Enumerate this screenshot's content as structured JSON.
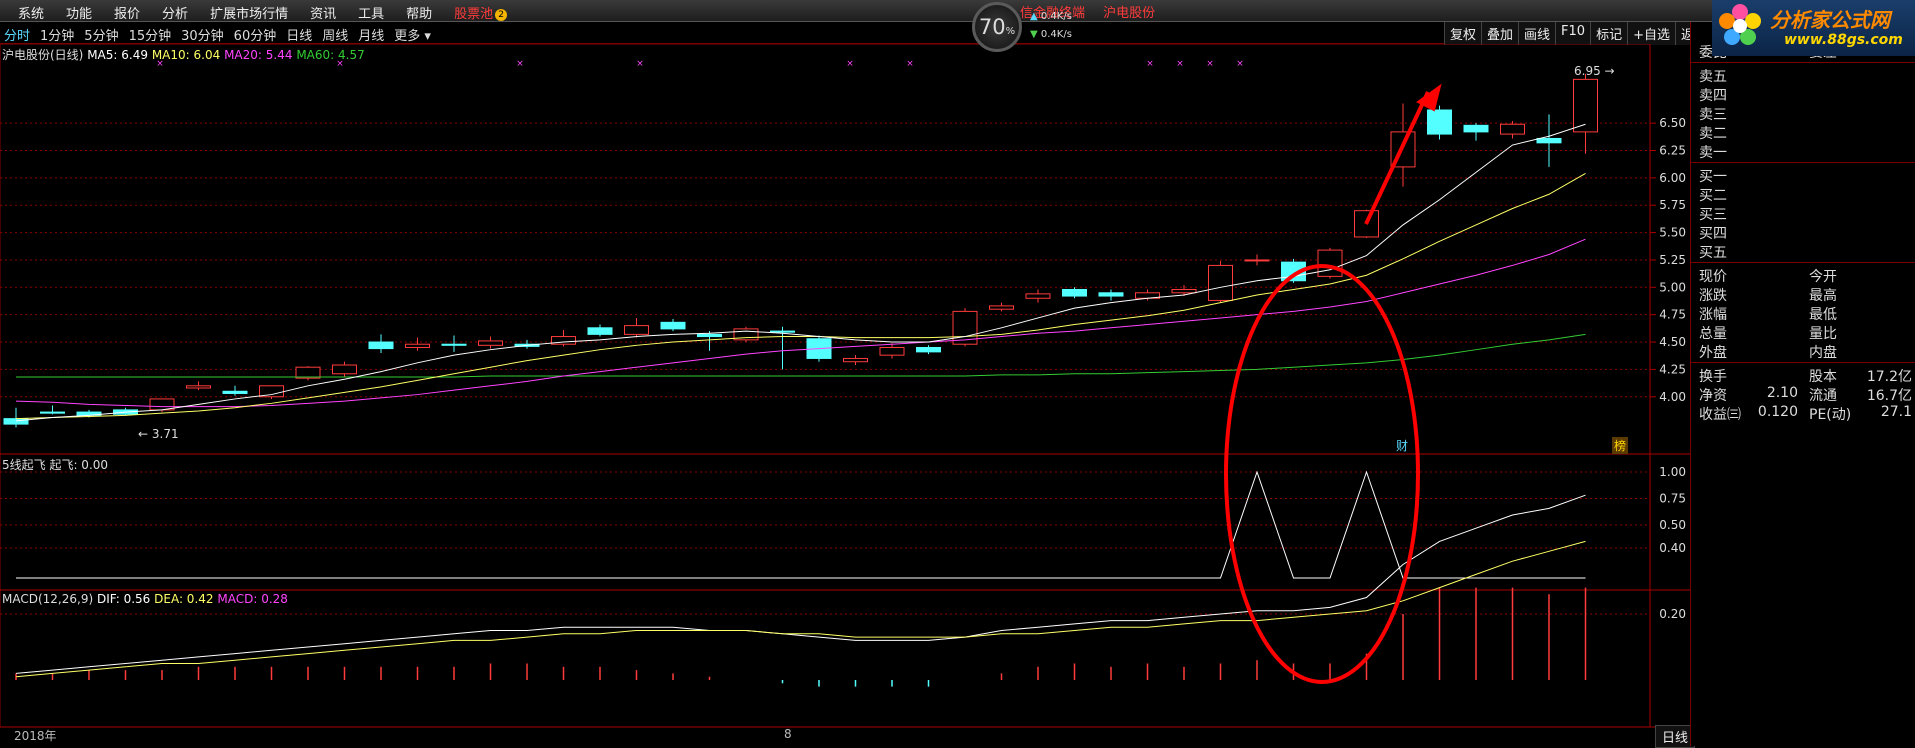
{
  "menu": {
    "items": [
      "系统",
      "功能",
      "报价",
      "分析",
      "扩展市场行情",
      "资讯",
      "工具",
      "帮助"
    ],
    "pool_label": "股票池",
    "pool_badge": "2"
  },
  "title_info": {
    "left": "信金融终端",
    "stock": "沪电股份"
  },
  "speed": {
    "percent": "70",
    "percent_sign": "%",
    "up_rate": "0.4",
    "down_rate": "0.4",
    "rate_unit": "K/s"
  },
  "logo": {
    "name": "分析家公式网",
    "url": "www.88gs.com"
  },
  "periods": [
    {
      "label": "分时",
      "active": true
    },
    {
      "label": "1分钟",
      "active": false
    },
    {
      "label": "5分钟",
      "active": false
    },
    {
      "label": "15分钟",
      "active": false
    },
    {
      "label": "30分钟",
      "active": false
    },
    {
      "label": "60分钟",
      "active": false
    },
    {
      "label": "日线",
      "active": false
    },
    {
      "label": "周线",
      "active": false
    },
    {
      "label": "月线",
      "active": false
    },
    {
      "label": "更多 ▾",
      "active": false
    }
  ],
  "right_buttons": [
    "复权",
    "叠加",
    "画线",
    "F10",
    "标记",
    "+自选",
    "返回"
  ],
  "legend": {
    "stock": "沪电股份(日线)",
    "ma5": "MA5: 6.49",
    "ma10": "MA10: 6.04",
    "ma20": "MA20: 5.44",
    "ma60": "MA60: 4.57",
    "ind1": "5线起飞  起飞: 0.00",
    "macd_name": "MACD(12,26,9)",
    "dif": "DIF: 0.56",
    "dea": "DEA: 0.42",
    "macd": "MACD: 0.28"
  },
  "colors": {
    "up": "#ff3b3b",
    "down": "#54ffff",
    "ma5": "#ffffff",
    "ma10": "#ffff66",
    "ma20": "#ff44ff",
    "ma60": "#33cc33",
    "grid": "#8a0000",
    "annotation": "#ff0000"
  },
  "marks": {
    "high": "6.95",
    "low": "3.71",
    "cai": "财",
    "bang": "榜"
  },
  "axis_labels": {
    "date1": "2018年",
    "date2": "8"
  },
  "daily_tab": "日线",
  "quote": {
    "header": {
      "left": "委比",
      "right": "委差"
    },
    "asks": [
      "卖五",
      "卖四",
      "卖三",
      "卖二",
      "卖一"
    ],
    "bids": [
      "买一",
      "买二",
      "买三",
      "买四",
      "买五"
    ],
    "stats": [
      {
        "l": "现价",
        "lv": "",
        "r": "今开",
        "rv": ""
      },
      {
        "l": "涨跌",
        "lv": "",
        "r": "最高",
        "rv": ""
      },
      {
        "l": "涨幅",
        "lv": "",
        "r": "最低",
        "rv": ""
      },
      {
        "l": "总量",
        "lv": "",
        "r": "量比",
        "rv": ""
      },
      {
        "l": "外盘",
        "lv": "",
        "r": "内盘",
        "rv": ""
      }
    ],
    "fin": [
      {
        "l": "换手",
        "lv": "",
        "r": "股本",
        "rv": "17.2亿"
      },
      {
        "l": "净资",
        "lv": "2.10",
        "r": "流通",
        "rv": "16.7亿"
      },
      {
        "l": "收益㈢",
        "lv": "0.120",
        "r": "PE(动)",
        "rv": "27.1"
      }
    ]
  },
  "chart_data": {
    "type": "candlestick",
    "price_ticks": [
      4.0,
      4.25,
      4.5,
      4.75,
      5.0,
      5.25,
      5.5,
      5.75,
      6.0,
      6.25,
      6.5
    ],
    "ind1_ticks": [
      0.5,
      0.75,
      1.0
    ],
    "macd_ticks": [
      0.2,
      0.4
    ],
    "candles": [
      [
        3.8,
        3.9,
        3.75,
        3.72
      ],
      [
        3.86,
        3.92,
        3.85,
        3.84
      ],
      [
        3.86,
        3.88,
        3.83,
        3.81
      ],
      [
        3.88,
        3.9,
        3.84,
        3.83
      ],
      [
        3.88,
        3.97,
        3.98,
        3.86
      ],
      [
        4.08,
        4.14,
        4.1,
        4.06
      ],
      [
        4.05,
        4.1,
        4.03,
        4.01
      ],
      [
        4.0,
        4.05,
        4.1,
        3.98
      ],
      [
        4.17,
        4.28,
        4.27,
        4.15
      ],
      [
        4.21,
        4.32,
        4.29,
        4.18
      ],
      [
        4.5,
        4.57,
        4.44,
        4.4
      ],
      [
        4.45,
        4.54,
        4.48,
        4.42
      ],
      [
        4.48,
        4.56,
        4.47,
        4.41
      ],
      [
        4.47,
        4.55,
        4.51,
        4.44
      ],
      [
        4.48,
        4.52,
        4.46,
        4.44
      ],
      [
        4.48,
        4.61,
        4.55,
        4.46
      ],
      [
        4.63,
        4.66,
        4.57,
        4.55
      ],
      [
        4.57,
        4.72,
        4.65,
        4.54
      ],
      [
        4.68,
        4.71,
        4.62,
        4.6
      ],
      [
        4.57,
        4.6,
        4.55,
        4.42
      ],
      [
        4.52,
        4.64,
        4.62,
        4.5
      ],
      [
        4.6,
        4.64,
        4.59,
        4.25
      ],
      [
        4.53,
        4.56,
        4.35,
        4.32
      ],
      [
        4.32,
        4.38,
        4.35,
        4.29
      ],
      [
        4.38,
        4.49,
        4.45,
        4.35
      ],
      [
        4.45,
        4.47,
        4.41,
        4.39
      ],
      [
        4.48,
        4.81,
        4.78,
        4.46
      ],
      [
        4.8,
        4.86,
        4.83,
        4.78
      ],
      [
        4.9,
        4.98,
        4.94,
        4.86
      ],
      [
        4.98,
        5.0,
        4.92,
        4.9
      ],
      [
        4.95,
        4.98,
        4.92,
        4.88
      ],
      [
        4.9,
        4.98,
        4.95,
        4.88
      ],
      [
        4.95,
        5.02,
        4.98,
        4.92
      ],
      [
        4.88,
        5.24,
        5.2,
        4.86
      ],
      [
        5.25,
        5.3,
        5.25,
        5.2
      ],
      [
        5.23,
        5.26,
        5.06,
        5.04
      ],
      [
        5.1,
        5.36,
        5.34,
        5.08
      ],
      [
        5.46,
        5.71,
        5.7,
        5.45
      ],
      [
        6.1,
        6.68,
        6.42,
        5.92
      ],
      [
        6.62,
        6.66,
        6.4,
        6.35
      ],
      [
        6.48,
        6.5,
        6.42,
        6.34
      ],
      [
        6.4,
        6.52,
        6.49,
        6.36
      ],
      [
        6.36,
        6.58,
        6.32,
        6.1
      ],
      [
        6.42,
        6.95,
        6.9,
        6.22
      ]
    ],
    "ma5": [
      3.78,
      3.81,
      3.83,
      3.86,
      3.88,
      3.93,
      3.98,
      4.02,
      4.1,
      4.16,
      4.23,
      4.31,
      4.38,
      4.43,
      4.47,
      4.5,
      4.52,
      4.55,
      4.57,
      4.58,
      4.6,
      4.58,
      4.55,
      4.52,
      4.5,
      4.5,
      4.55,
      4.63,
      4.72,
      4.81,
      4.86,
      4.9,
      4.93,
      5.0,
      5.06,
      5.1,
      5.16,
      5.29,
      5.57,
      5.8,
      6.05,
      6.3,
      6.38,
      6.49
    ],
    "ma10": [
      3.8,
      3.81,
      3.82,
      3.83,
      3.85,
      3.87,
      3.9,
      3.94,
      3.99,
      4.04,
      4.09,
      4.15,
      4.21,
      4.27,
      4.33,
      4.38,
      4.43,
      4.47,
      4.5,
      4.52,
      4.54,
      4.55,
      4.55,
      4.54,
      4.54,
      4.54,
      4.55,
      4.57,
      4.61,
      4.66,
      4.7,
      4.74,
      4.79,
      4.86,
      4.93,
      4.98,
      5.03,
      5.11,
      5.26,
      5.42,
      5.57,
      5.72,
      5.85,
      6.04
    ],
    "ma20": [
      3.96,
      3.95,
      3.93,
      3.92,
      3.91,
      3.91,
      3.91,
      3.92,
      3.94,
      3.96,
      3.99,
      4.02,
      4.06,
      4.1,
      4.14,
      4.19,
      4.23,
      4.27,
      4.31,
      4.35,
      4.39,
      4.42,
      4.44,
      4.46,
      4.48,
      4.5,
      4.52,
      4.55,
      4.58,
      4.6,
      4.63,
      4.66,
      4.69,
      4.72,
      4.75,
      4.78,
      4.82,
      4.87,
      4.95,
      5.03,
      5.11,
      5.2,
      5.3,
      5.44
    ],
    "ma60": [
      4.18,
      4.18,
      4.18,
      4.18,
      4.18,
      4.18,
      4.18,
      4.18,
      4.18,
      4.18,
      4.18,
      4.18,
      4.18,
      4.19,
      4.19,
      4.19,
      4.19,
      4.19,
      4.19,
      4.19,
      4.19,
      4.19,
      4.19,
      4.19,
      4.19,
      4.19,
      4.19,
      4.2,
      4.2,
      4.21,
      4.21,
      4.22,
      4.23,
      4.24,
      4.25,
      4.27,
      4.29,
      4.31,
      4.34,
      4.38,
      4.43,
      4.48,
      4.52,
      4.57
    ],
    "ind1": [
      0,
      0,
      0,
      0,
      0,
      0,
      0,
      0,
      0,
      0,
      0,
      0,
      0,
      0,
      0,
      0,
      0,
      0,
      0,
      0,
      0,
      0,
      0,
      0,
      0,
      0,
      0,
      0,
      0,
      0,
      0,
      0,
      0,
      0,
      1,
      0,
      0,
      1,
      0,
      0,
      0,
      0,
      0,
      0
    ],
    "dif": [
      0.02,
      0.03,
      0.04,
      0.05,
      0.06,
      0.07,
      0.08,
      0.09,
      0.1,
      0.11,
      0.12,
      0.13,
      0.14,
      0.15,
      0.15,
      0.16,
      0.16,
      0.16,
      0.16,
      0.15,
      0.15,
      0.14,
      0.13,
      0.12,
      0.12,
      0.12,
      0.13,
      0.15,
      0.16,
      0.17,
      0.18,
      0.18,
      0.19,
      0.2,
      0.21,
      0.21,
      0.22,
      0.25,
      0.35,
      0.42,
      0.46,
      0.5,
      0.52,
      0.56
    ],
    "dea": [
      0.01,
      0.02,
      0.03,
      0.04,
      0.05,
      0.05,
      0.06,
      0.07,
      0.08,
      0.09,
      0.1,
      0.11,
      0.12,
      0.12,
      0.13,
      0.14,
      0.14,
      0.15,
      0.15,
      0.15,
      0.15,
      0.14,
      0.14,
      0.13,
      0.13,
      0.13,
      0.13,
      0.14,
      0.14,
      0.15,
      0.16,
      0.16,
      0.17,
      0.18,
      0.18,
      0.19,
      0.2,
      0.21,
      0.24,
      0.28,
      0.32,
      0.36,
      0.39,
      0.42
    ],
    "macdbar": [
      0.02,
      0.02,
      0.03,
      0.03,
      0.03,
      0.04,
      0.04,
      0.04,
      0.04,
      0.04,
      0.04,
      0.04,
      0.04,
      0.05,
      0.05,
      0.04,
      0.04,
      0.03,
      0.02,
      0.01,
      0.0,
      -0.01,
      -0.02,
      -0.02,
      -0.02,
      -0.02,
      0.0,
      0.02,
      0.04,
      0.05,
      0.04,
      0.05,
      0.04,
      0.05,
      0.06,
      0.05,
      0.05,
      0.08,
      0.2,
      0.28,
      0.28,
      0.28,
      0.26,
      0.28
    ]
  }
}
